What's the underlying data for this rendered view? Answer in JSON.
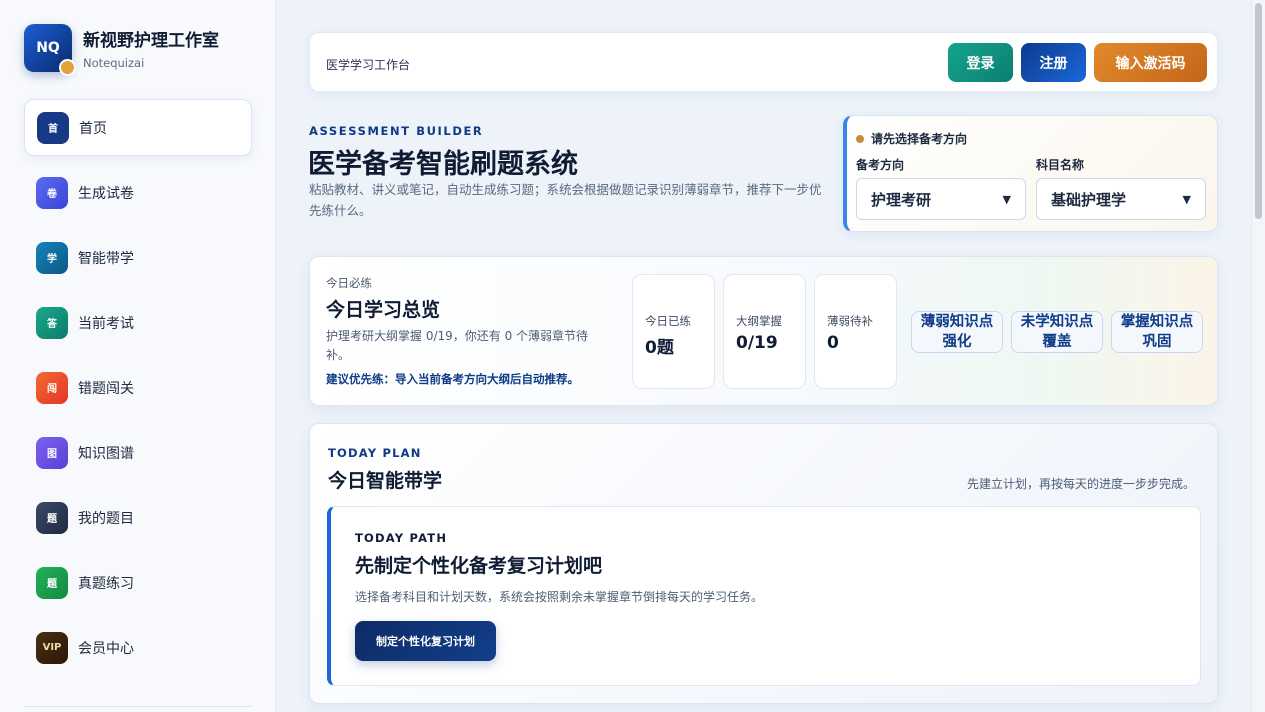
{
  "brand": {
    "logo": "NQ",
    "title": "新视野护理工作室",
    "subtitle": "Notequizai"
  },
  "sidebar": {
    "items": [
      {
        "badge": "首",
        "label": "首页",
        "color": "#163a86",
        "active": true
      },
      {
        "badge": "卷",
        "label": "生成试卷",
        "color": "#4a56e8"
      },
      {
        "badge": "学",
        "label": "智能带学",
        "color": "#0e6fa0"
      },
      {
        "badge": "答",
        "label": "当前考试",
        "color": "#13957c"
      },
      {
        "badge": "闯",
        "label": "错题闯关",
        "color": "#ec4e2c"
      },
      {
        "badge": "图",
        "label": "知识图谱",
        "color": "#6a4fe0"
      },
      {
        "badge": "题",
        "label": "我的题目",
        "color": "#2a3a55"
      },
      {
        "badge": "题",
        "label": "真题练习",
        "color": "#1a9a4c"
      },
      {
        "badge": "VIP",
        "label": "会员中心",
        "color": "#3a2410"
      }
    ]
  },
  "topbar": {
    "title": "医学学习工作台",
    "login_label": "登录",
    "register_label": "注册",
    "activate_label": "输入激活码"
  },
  "hero": {
    "eyebrow": "ASSESSMENT BUILDER",
    "title": "医学备考智能刷题系统",
    "description": "粘贴教材、讲义或笔记，自动生成练习题；系统会根据做题记录识别薄弱章节，推荐下一步优先练什么。"
  },
  "direction": {
    "hint": "请先选择备考方向",
    "direction_label": "备考方向",
    "direction_value": "护理考研",
    "subject_label": "科目名称",
    "subject_value": "基础护理学"
  },
  "summary": {
    "eyebrow": "今日必练",
    "title": "今日学习总览",
    "description": "护理考研大纲掌握 0/19，你还有 0 个薄弱章节待补。",
    "suggestion": "建议优先练：导入当前备考方向大纲后自动推荐。",
    "stats": [
      {
        "label": "今日已练",
        "value": "0题"
      },
      {
        "label": "大纲掌握",
        "value": "0/19"
      },
      {
        "label": "薄弱待补",
        "value": "0"
      }
    ],
    "actions": [
      "薄弱知识点强化",
      "未学知识点覆盖",
      "掌握知识点巩固"
    ]
  },
  "plan": {
    "eyebrow": "TODAY PLAN",
    "title": "今日智能带学",
    "note": "先建立计划，再按每天的进度一步步完成。",
    "path": {
      "eyebrow": "TODAY PATH",
      "title": "先制定个性化备考复习计划吧",
      "description": "选择备考科目和计划天数，系统会按照剩余未掌握章节倒排每天的学习任务。",
      "button_label": "制定个性化复习计划"
    }
  },
  "colors": {
    "accent": "#1a67d9",
    "login": "#14a38b",
    "activate": "#e18a2b",
    "brand_dot": "#e0a23a"
  }
}
